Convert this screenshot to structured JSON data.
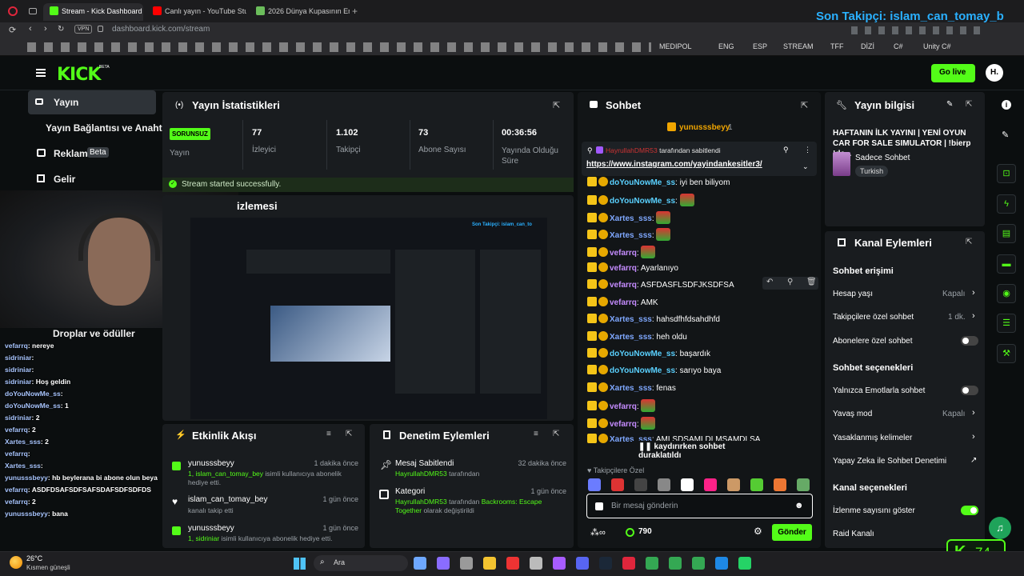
{
  "browser": {
    "tabs": [
      {
        "label": "Stream - Kick Dashboard",
        "color": "#53fc18"
      },
      {
        "label": "Canlı yayın - YouTube Studio",
        "color": "#ff0000"
      },
      {
        "label": "2026 Dünya Kupasının En B",
        "color": "#6bbd5b"
      }
    ],
    "vpn": "VPN",
    "url": "dashboard.kick.com/stream",
    "bookmarks": [
      "MEDIPOL",
      "ENG",
      "ESP",
      "STREAM",
      "TFF",
      "DİZİ",
      "C#",
      "Unity C#"
    ]
  },
  "overlay_top": "Son Takipçi: islam_can_tomay_b",
  "header": {
    "logo": "KICK",
    "logo_beta": "BETA",
    "golive": "Go live",
    "avatar": "H."
  },
  "sidebar": {
    "items": [
      {
        "label": "Yayın"
      },
      {
        "label": "Yayın Bağlantısı ve Anahtarı"
      },
      {
        "label": "Reklam",
        "badge": "Beta"
      },
      {
        "label": "Gelir"
      },
      {
        "label": "Droplar ve ödüller"
      }
    ]
  },
  "stats": {
    "title": "Yayın İstatistikleri",
    "status": "SORUNSUZ",
    "status_label": "Yayın",
    "items": [
      {
        "value": "77",
        "label": "İzleyici"
      },
      {
        "value": "1.102",
        "label": "Takipçi"
      },
      {
        "value": "73",
        "label": "Abone Sayısı"
      },
      {
        "value": "00:36:56",
        "label": "Yayında Olduğu Süre"
      }
    ],
    "success": "Stream started successfully."
  },
  "preview": {
    "title_partial": "izlemesi"
  },
  "activity": {
    "title": "Etkinlik Akışı",
    "items": [
      {
        "user": "yunusssbeyy",
        "time": "1 dakika önce",
        "hl": "1, islam_can_tomay_bey",
        "sub": " isimli kullanıcıya abonelik hediye etti."
      },
      {
        "user": "islam_can_tomay_bey",
        "time": "1 gün önce",
        "hl": "",
        "sub": "kanalı takip etti"
      },
      {
        "user": "yunusssbeyy",
        "time": "1 gün önce",
        "hl": "1, sidriniar",
        "sub": " isimli kullanıcıya abonelik hediye etti."
      }
    ]
  },
  "moderation": {
    "title": "Denetim Eylemleri",
    "items": [
      {
        "title": "Mesaj Sabitlendi",
        "time": "32 dakika önce",
        "hl": "HayrullahDMR53",
        "sub": " tarafından"
      },
      {
        "title": "Kategori",
        "time": "1 gün önce",
        "hl": "HayrullahDMR53",
        "sub": " tarafından ",
        "hl2": "Backrooms: Escape Together",
        "sub2": " olarak değiştirildi"
      }
    ]
  },
  "chat": {
    "title": "Sohbet",
    "gifter": "yunusssbeyy",
    "gifter_count": "1",
    "pinned_by": "HayrullahDMR53",
    "pinned_suffix": "tarafından sabitlendi",
    "pinned_link": "https://www.instagram.com/yayindankesitler3/",
    "messages": [
      {
        "user": "doYouNowMe_ss",
        "text": "iyi ben biliyom",
        "color": "#5ad1ff"
      },
      {
        "user": "doYouNowMe_ss",
        "text": "",
        "color": "#5ad1ff"
      },
      {
        "user": "Xartes_sss",
        "text": "",
        "color": "#7fa8ff"
      },
      {
        "user": "Xartes_sss",
        "text": "",
        "color": "#7fa8ff"
      },
      {
        "user": "vefarrq",
        "text": "",
        "color": "#c58cff"
      },
      {
        "user": "vefarrq",
        "text": "Ayarlanıyo",
        "color": "#c58cff"
      },
      {
        "user": "vefarrq",
        "text": "ASFDASFLSDFJKSDFSA",
        "color": "#c58cff"
      },
      {
        "user": "vefarrq",
        "text": "AMK",
        "color": "#c58cff"
      },
      {
        "user": "Xartes_sss",
        "text": "hahsdfhfdsahdhfd",
        "color": "#7fa8ff"
      },
      {
        "user": "Xartes_sss",
        "text": "heh oldu",
        "color": "#7fa8ff"
      },
      {
        "user": "doYouNowMe_ss",
        "text": "başardık",
        "color": "#5ad1ff"
      },
      {
        "user": "doYouNowMe_ss",
        "text": "sarıyo baya",
        "color": "#5ad1ff"
      },
      {
        "user": "Xartes_sss",
        "text": "fenas",
        "color": "#7fa8ff"
      },
      {
        "user": "vefarrq",
        "text": "",
        "color": "#c58cff"
      },
      {
        "user": "vefarrq",
        "text": "",
        "color": "#c58cff"
      },
      {
        "user": "Xartes_sss",
        "text": "AMLSDSAMLDLMSAMDLSA",
        "color": "#7fa8ff"
      }
    ],
    "paused": "kaydırırken sohbet duraklatıldı",
    "follower_only": "Takipçilere Özel",
    "input_placeholder": "Bir mesaj gönderin",
    "points": "790",
    "send": "Gönder"
  },
  "stream_info": {
    "title": "Yayın bilgisi",
    "stream_title": "HAFTANIN İLK YAYINI | YENİ OYUN CAR FOR SALE SIMULATOR | !bierp !dc...",
    "category": "Sadece Sohbet",
    "language": "Turkish"
  },
  "channel_actions": {
    "title": "Kanal Eylemleri",
    "section_chat_access": "Sohbet erişimi",
    "account_age": "Hesap yaşı",
    "account_age_val": "Kapalı",
    "followers_only": "Takipçilere özel sohbet",
    "followers_only_val": "1 dk.",
    "subs_only": "Abonelere özel sohbet",
    "section_chat_options": "Sohbet seçenekleri",
    "emotes_only": "Yalnızca Emotlarla sohbet",
    "slow_mode": "Yavaş mod",
    "slow_mode_val": "Kapalı",
    "banned_words": "Yasaklanmış kelimeler",
    "ai_moderation": "Yapay Zeka ile Sohbet Denetimi",
    "section_channel_options": "Kanal seçenekleri",
    "show_viewers": "İzlenme sayısını göster",
    "raid": "Raid Kanalı"
  },
  "overlay_chat": [
    {
      "user": "vefarrq",
      "text": ": nereye"
    },
    {
      "user": "sidriniar",
      "text": ":"
    },
    {
      "user": "sidriniar",
      "text": ":"
    },
    {
      "user": "sidriniar",
      "text": ": Hoş geldin"
    },
    {
      "user": "doYouNowMe_ss",
      "text": ":"
    },
    {
      "user": "doYouNowMe_ss",
      "text": ": 1"
    },
    {
      "user": "sidriniar",
      "text": ": 2"
    },
    {
      "user": "vefarrq",
      "text": ": 2"
    },
    {
      "user": "Xartes_sss",
      "text": ": 2"
    },
    {
      "user": "vefarrq",
      "text": ":"
    },
    {
      "user": "Xartes_sss",
      "text": ":"
    },
    {
      "user": "yunusssbeyy",
      "text": ": hb beylerana bi abone olun beya"
    },
    {
      "user": "vefarrq",
      "text": ": ASDFDSAFSDFSAFSDAFSDFSDFDS"
    },
    {
      "user": "vefarrq",
      "text": ": 2"
    },
    {
      "user": "yunusssbeyy",
      "text": ": bana"
    }
  ],
  "overlay_viewers": "74",
  "taskbar": {
    "temp": "26°C",
    "weather": "Kısmen güneşli",
    "search": "Ara"
  }
}
